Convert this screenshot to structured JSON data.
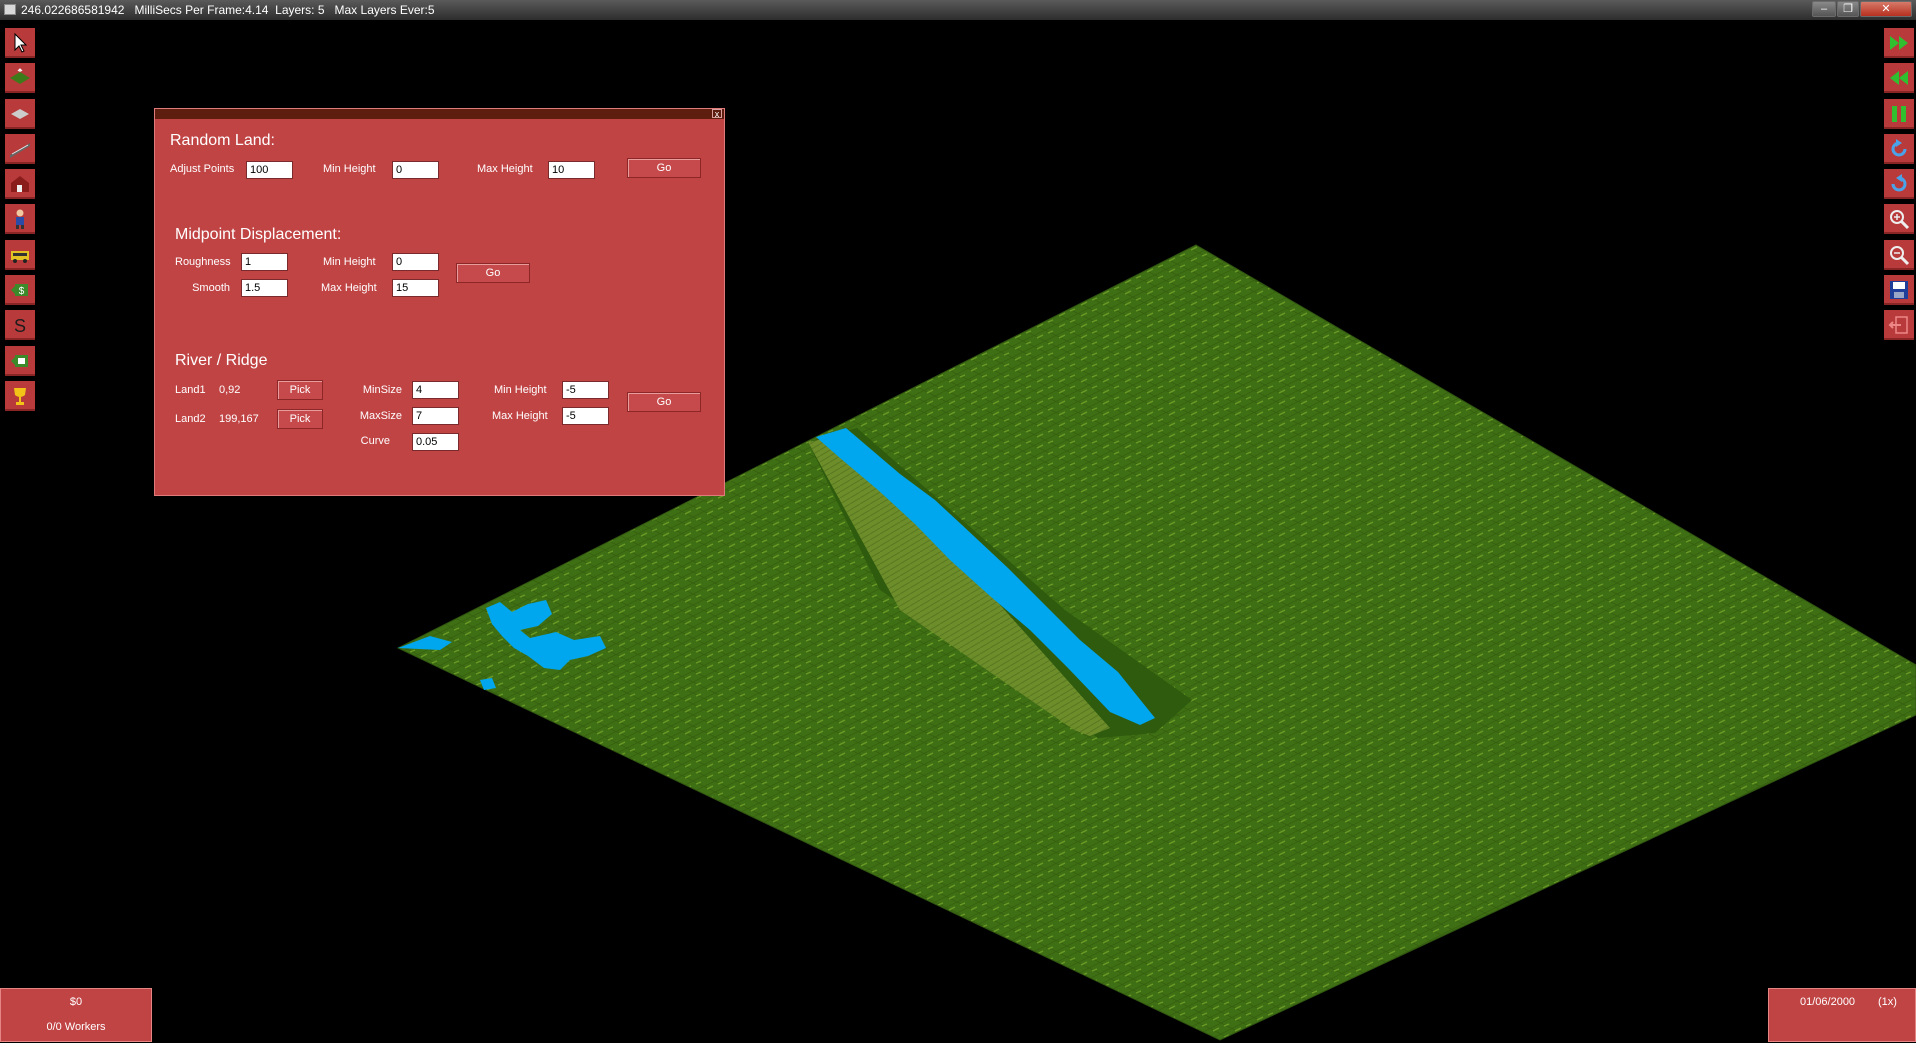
{
  "titlebar": {
    "text": "246.022686581942   MilliSecs Per Frame:4.14  Layers: 5   Max Layers Ever:5",
    "buttons": {
      "minimize": "–",
      "restore": "❐",
      "close": "✕"
    }
  },
  "left_toolbar": [
    {
      "name": "pointer-icon"
    },
    {
      "name": "raise-land-icon"
    },
    {
      "name": "flatten-land-icon"
    },
    {
      "name": "road-icon"
    },
    {
      "name": "house-icon"
    },
    {
      "name": "worker-icon"
    },
    {
      "name": "vehicle-icon"
    },
    {
      "name": "money-icon"
    },
    {
      "name": "stats-s-icon",
      "glyph": "S"
    },
    {
      "name": "budget-icon"
    },
    {
      "name": "trophy-icon"
    }
  ],
  "right_toolbar": [
    {
      "name": "fast-forward-icon"
    },
    {
      "name": "rewind-icon"
    },
    {
      "name": "pause-icon"
    },
    {
      "name": "rotate-left-icon"
    },
    {
      "name": "rotate-right-icon"
    },
    {
      "name": "zoom-in-icon"
    },
    {
      "name": "zoom-out-icon"
    },
    {
      "name": "save-icon"
    },
    {
      "name": "exit-icon"
    }
  ],
  "panel": {
    "close_glyph": "x",
    "random_land": {
      "title": "Random Land:",
      "adjust_points_label": "Adjust Points",
      "adjust_points": "100",
      "min_height_label": "Min Height",
      "min_height": "0",
      "max_height_label": "Max Height",
      "max_height": "10",
      "go": "Go"
    },
    "midpoint": {
      "title": "Midpoint Displacement:",
      "roughness_label": "Roughness",
      "roughness": "1",
      "smooth_label": "Smooth",
      "smooth": "1.5",
      "min_height_label": "Min Height",
      "min_height": "0",
      "max_height_label": "Max Height",
      "max_height": "15",
      "go": "Go"
    },
    "river": {
      "title": "River / Ridge",
      "land1_label": "Land1",
      "land1_value": "0,92",
      "pick1": "Pick",
      "land2_label": "Land2",
      "land2_value": "199,167",
      "pick2": "Pick",
      "minsize_label": "MinSize",
      "minsize": "4",
      "maxsize_label": "MaxSize",
      "maxsize": "7",
      "curve_label": "Curve",
      "curve": "0.05",
      "min_height_label": "Min Height",
      "min_height": "-5",
      "max_height_label": "Max Height",
      "max_height": "-5",
      "go": "Go"
    }
  },
  "status_left": {
    "money": "$0",
    "workers": "0/0 Workers"
  },
  "status_right": {
    "date": "01/06/2000",
    "speed": "(1x)"
  },
  "colors": {
    "panel": "#c14445",
    "grass": "#3f6f14",
    "water": "#00a6ee",
    "ridge": "#6f8f2c"
  }
}
